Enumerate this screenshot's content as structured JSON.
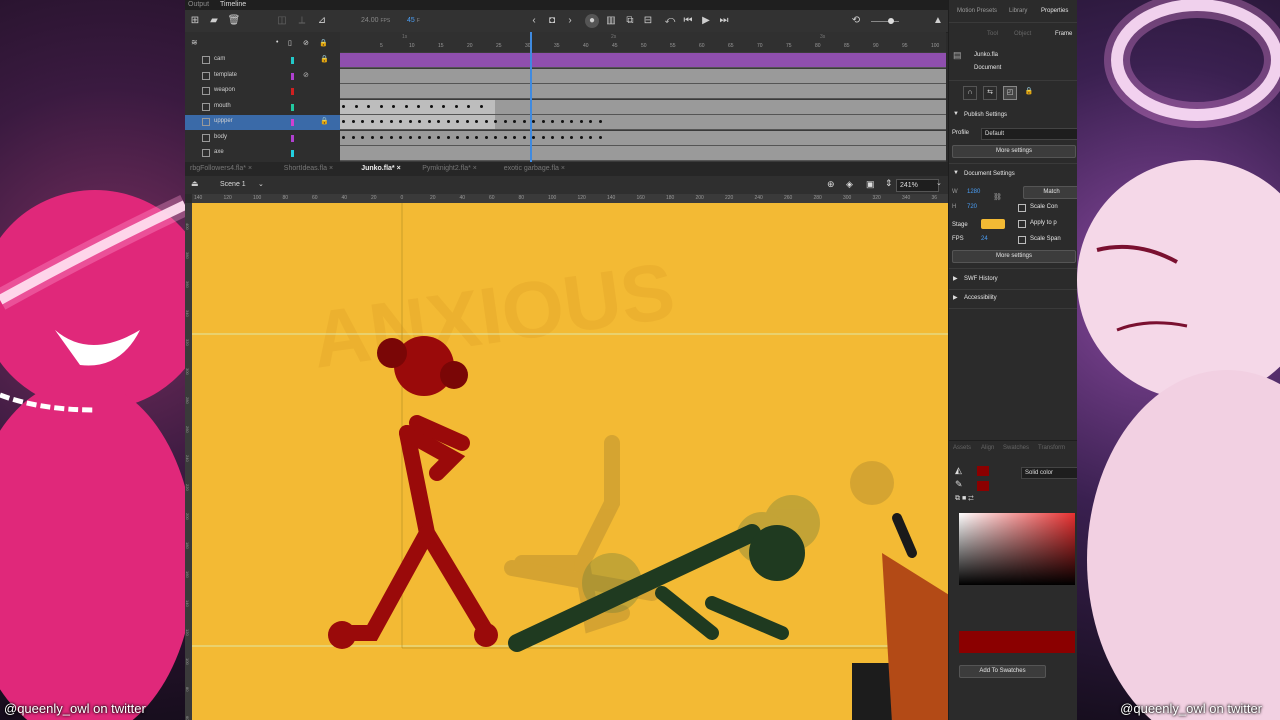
{
  "app": {
    "top_tabs": [
      "Output",
      "Timeline"
    ],
    "fps": "24.00",
    "fps_unit": "FPS",
    "frame": "45",
    "frame_unit": "F",
    "frame_numbers": [
      "5",
      "10",
      "15",
      "20",
      "25",
      "30",
      "35",
      "40",
      "45",
      "50",
      "55",
      "60",
      "65",
      "70",
      "75",
      "80",
      "85",
      "90",
      "95",
      "100",
      "105",
      "11"
    ],
    "seconds_marks": [
      "1s",
      "2s",
      "3s",
      "4s"
    ]
  },
  "layers": [
    {
      "name": "cam",
      "color": "#22c9c9",
      "locked": true,
      "hidden": false,
      "selected": false
    },
    {
      "name": "template",
      "color": "#b040d0",
      "locked": false,
      "hidden": true,
      "selected": false
    },
    {
      "name": "weapon",
      "color": "#d02020",
      "locked": false,
      "hidden": false,
      "selected": false
    },
    {
      "name": "mouth",
      "color": "#22c9a0",
      "locked": false,
      "hidden": false,
      "selected": false
    },
    {
      "name": "uppper",
      "color": "#d040d0",
      "locked": true,
      "hidden": false,
      "selected": true
    },
    {
      "name": "body",
      "color": "#b040d0",
      "locked": false,
      "hidden": false,
      "selected": false
    },
    {
      "name": "axe",
      "color": "#22d0e0",
      "locked": false,
      "hidden": false,
      "selected": false
    }
  ],
  "doc_tabs": [
    "rbgFollowers4.fla*",
    "ShortIdeas.fla",
    "Junko.fla*",
    "Pymknight2.fla*",
    "exotic garbage.fla"
  ],
  "active_doc": "Junko.fla*",
  "scene": "Scene 1",
  "zoom": "241%",
  "ruler_h": [
    "140",
    "120",
    "100",
    "80",
    "60",
    "40",
    "20",
    "0",
    "20",
    "40",
    "60",
    "80",
    "100",
    "120",
    "140",
    "160",
    "180",
    "200",
    "220",
    "240",
    "260",
    "280",
    "300",
    "320",
    "340",
    "36"
  ],
  "ruler_v": [
    "400",
    "380",
    "360",
    "340",
    "320",
    "300",
    "280",
    "260",
    "240",
    "220",
    "200",
    "180",
    "160",
    "140",
    "120",
    "100",
    "80",
    "60"
  ],
  "stage_ghost_text": "ANXIOUS",
  "panel": {
    "tabs": [
      "Motion Presets",
      "Library",
      "Properties"
    ],
    "subtabs": [
      "Tool",
      "Object",
      "Frame"
    ],
    "doc_name": "Junko.fla",
    "doc_type": "Document",
    "publish_title": "Publish Settings",
    "profile_label": "Profile",
    "profile_value": "Default",
    "more_settings": "More settings",
    "docsettings_title": "Document Settings",
    "w_label": "W",
    "w_value": "1280",
    "h_label": "H",
    "h_value": "720",
    "match_label": "Match",
    "scale_content": "Scale Con",
    "apply_to": "Apply to p",
    "scale_spans": "Scale Span",
    "stage_label": "Stage",
    "stage_color": "#f3ba34",
    "fps_label": "FPS",
    "fps_value": "24",
    "swf_history": "SWF History",
    "accessibility": "Accessibility",
    "lower_tabs": [
      "Assets",
      "Align",
      "Swatches",
      "Transform"
    ],
    "fill_type": "Solid color",
    "fill_color": "#8b0000",
    "add_swatch": "Add To Swatches"
  },
  "credits": {
    "left": "@queenly_owl on twitter",
    "right": "@queenly_owl on twitter"
  }
}
